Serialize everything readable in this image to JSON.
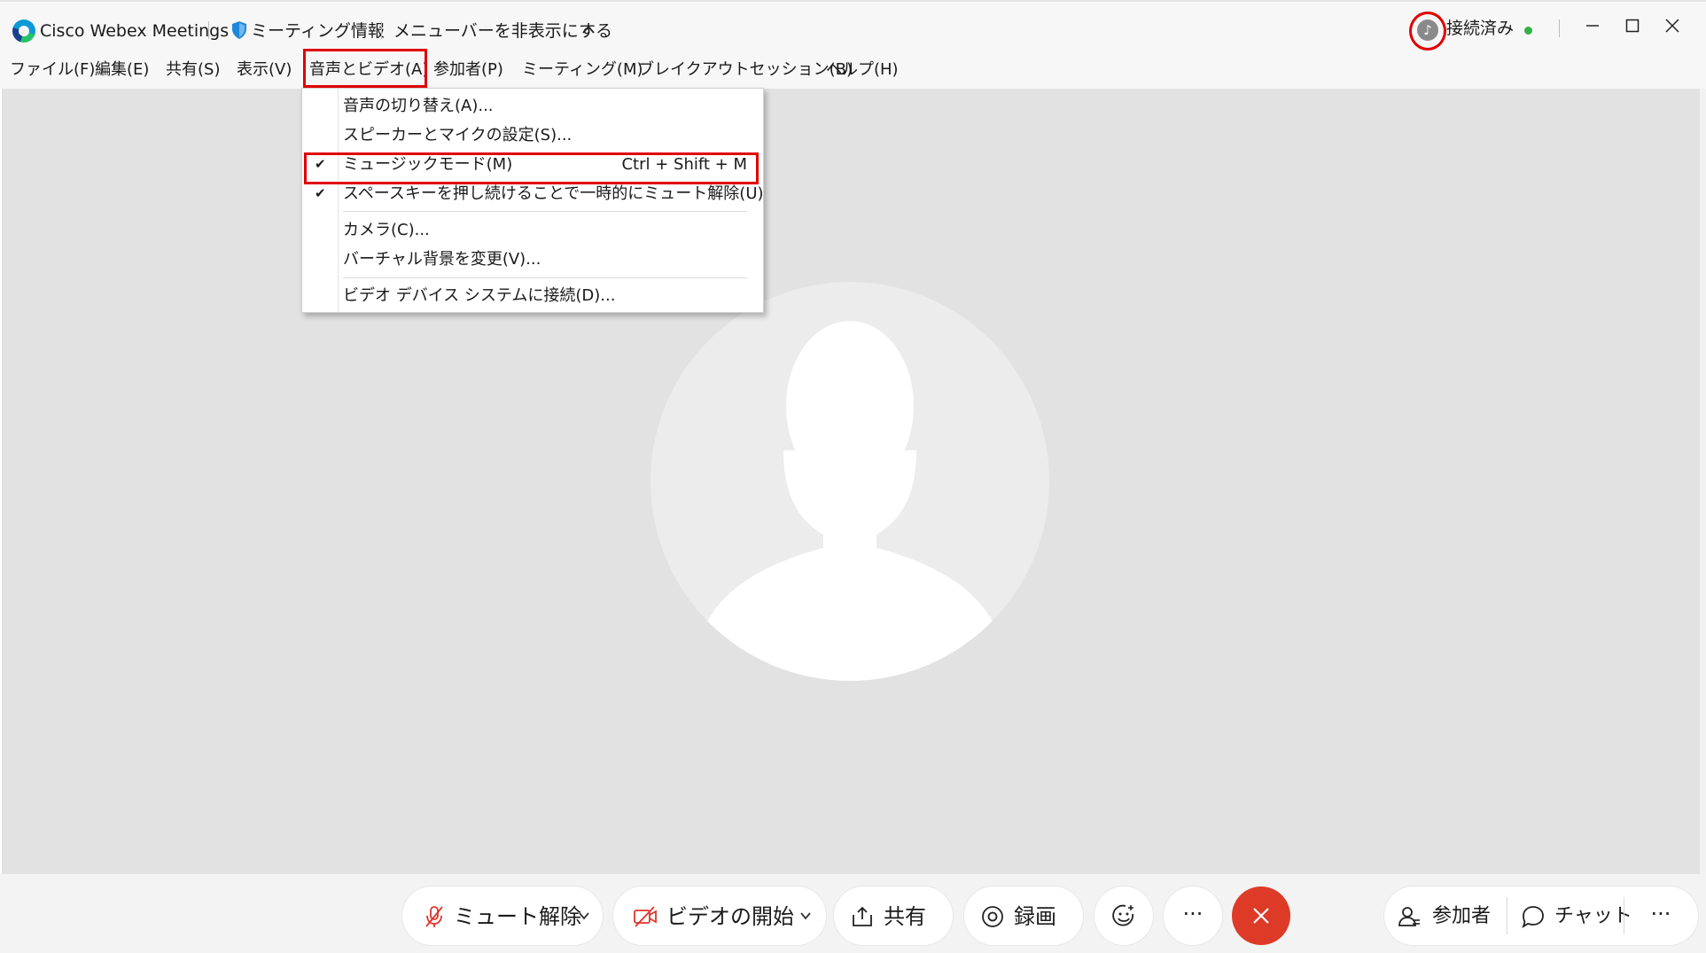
{
  "titlebar": {
    "app_name": "Cisco Webex Meetings",
    "meeting_info": "ミーティング情報",
    "hide_menubar": "メニューバーを非表示にする",
    "status": "接続済み",
    "chevron": "^"
  },
  "menubar": {
    "items": [
      "ファイル(F)",
      "編集(E)",
      "共有(S)",
      "表示(V)",
      "音声とビデオ(A)",
      "参加者(P)",
      "ミーティング(M)",
      "ブレイクアウトセッション(B)",
      "ヘルプ(H)"
    ]
  },
  "dropdown": {
    "items": [
      {
        "label": "音声の切り替え(A)...",
        "checked": false
      },
      {
        "label": "スピーカーとマイクの設定(S)...",
        "checked": false
      },
      {
        "label": "ミュージックモード(M)",
        "checked": true,
        "shortcut": "Ctrl + Shift + M"
      },
      {
        "label": "スペースキーを押し続けることで一時的にミュート解除(U)",
        "checked": true
      },
      {
        "label": "カメラ(C)...",
        "checked": false
      },
      {
        "label": "バーチャル背景を変更(V)...",
        "checked": false
      },
      {
        "label": "ビデオ デバイス システムに接続(D)...",
        "checked": false
      }
    ],
    "check_glyph": "✔"
  },
  "controls": {
    "unmute": "ミュート解除",
    "start_video": "ビデオの開始",
    "share": "共有",
    "record": "録画",
    "more": "···",
    "participants": "参加者",
    "chat": "チャット"
  },
  "colors": {
    "highlight_red": "#e00000",
    "end_call": "#dd3a28",
    "status_green": "#2fb34a",
    "mute_icon": "#e0352b"
  },
  "icons": [
    "webex-logo-icon",
    "shield-icon",
    "chevron-up-icon",
    "music-icon",
    "minimize-icon",
    "maximize-icon",
    "close-icon",
    "microphone-muted-icon",
    "video-off-icon",
    "share-icon",
    "record-icon",
    "reaction-icon",
    "more-icon",
    "end-call-icon",
    "participants-icon",
    "chat-icon",
    "checkmark-icon"
  ]
}
